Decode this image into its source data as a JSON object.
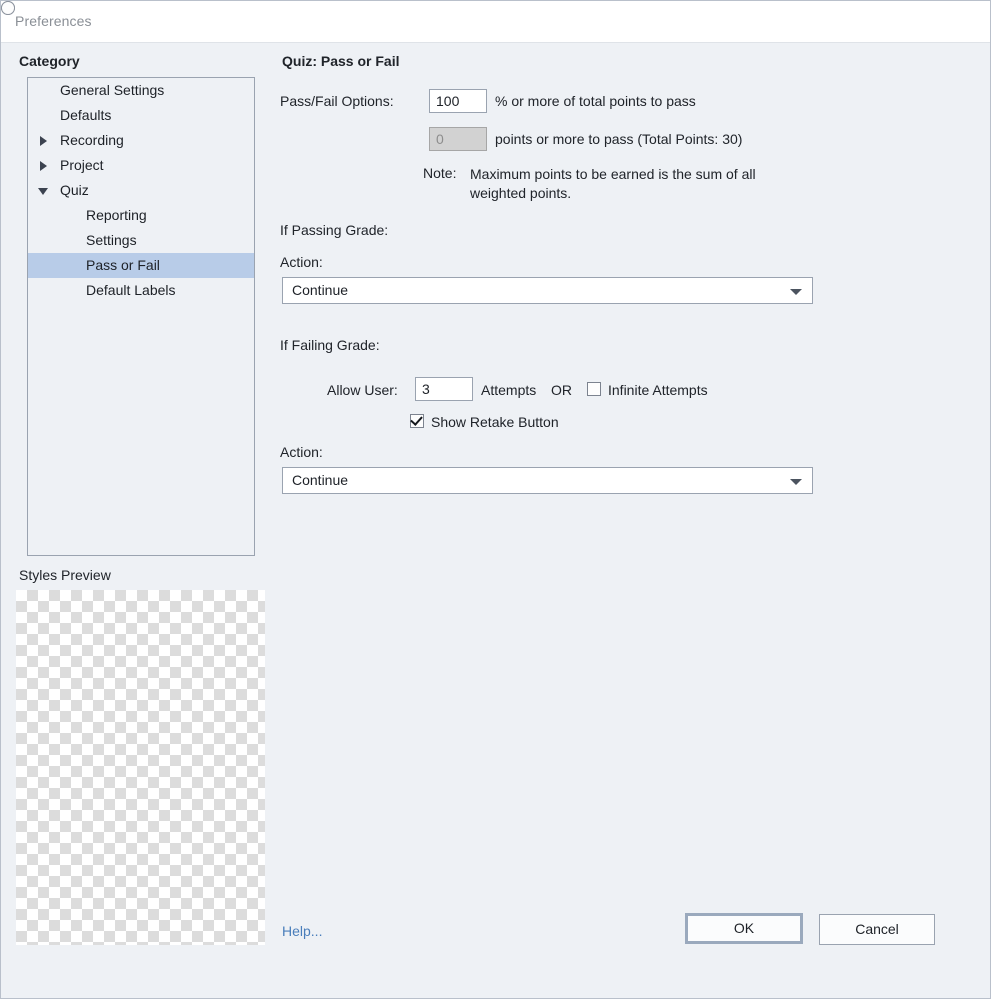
{
  "window": {
    "title": "Preferences"
  },
  "sidebar": {
    "heading": "Category",
    "items": [
      {
        "label": "General Settings",
        "depth": 1,
        "twisty": "none",
        "selected": false
      },
      {
        "label": "Defaults",
        "depth": 1,
        "twisty": "none",
        "selected": false
      },
      {
        "label": "Recording",
        "depth": 1,
        "twisty": "collapsed",
        "selected": false
      },
      {
        "label": "Project",
        "depth": 1,
        "twisty": "collapsed",
        "selected": false
      },
      {
        "label": "Quiz",
        "depth": 1,
        "twisty": "expanded",
        "selected": false
      },
      {
        "label": "Reporting",
        "depth": 2,
        "twisty": "none",
        "selected": false
      },
      {
        "label": "Settings",
        "depth": 2,
        "twisty": "none",
        "selected": false
      },
      {
        "label": "Pass or Fail",
        "depth": 2,
        "twisty": "none",
        "selected": true
      },
      {
        "label": "Default Labels",
        "depth": 2,
        "twisty": "none",
        "selected": false
      }
    ],
    "styles_preview_label": "Styles Preview"
  },
  "main": {
    "title": "Quiz: Pass or Fail",
    "passfail": {
      "label": "Pass/Fail Options:",
      "percent_option": {
        "selected": true,
        "value": "100",
        "suffix": "% or more of total points to pass"
      },
      "points_option": {
        "selected": false,
        "value": "0",
        "disabled": true,
        "suffix": "points or more to pass (Total Points: 30)"
      },
      "note_word": "Note:",
      "note_text": "Maximum points to be earned is the sum of all weighted points."
    },
    "passing_grade": {
      "heading": "If Passing Grade:",
      "action_label": "Action:",
      "action_value": "Continue"
    },
    "failing_grade": {
      "heading": "If Failing Grade:",
      "allow_user_label": "Allow User:",
      "attempts_value": "3",
      "attempts_word": "Attempts",
      "or_word": "OR",
      "infinite_attempts_label": "Infinite Attempts",
      "infinite_attempts_checked": false,
      "show_retake_label": "Show Retake Button",
      "show_retake_checked": true,
      "action_label": "Action:",
      "action_value": "Continue"
    }
  },
  "footer": {
    "help_label": "Help...",
    "ok_label": "OK",
    "cancel_label": "Cancel"
  },
  "colors": {
    "selection": "#b8cce8",
    "link": "#4a7ebb",
    "panel_bg": "#eef1f5"
  }
}
